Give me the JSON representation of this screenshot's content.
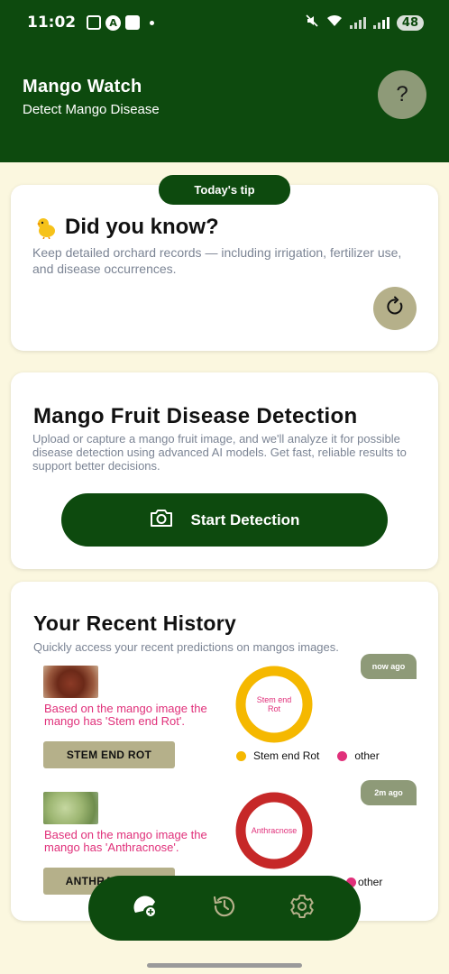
{
  "status_bar": {
    "time": "11:02",
    "battery": "48"
  },
  "header": {
    "title": "Mango Watch",
    "subtitle": "Detect Mango Disease",
    "help_label": "?"
  },
  "tip": {
    "badge": "Today's tip",
    "title": "Did you know?",
    "text": "Keep detailed orchard records — including irrigation, fertilizer use, and disease occurrences."
  },
  "detection": {
    "title": "Mango Fruit Disease Detection",
    "text": "Upload or capture a mango fruit image, and we'll analyze it for possible disease detection using advanced AI models. Get fast, reliable results to support better decisions.",
    "button_label": "Start Detection"
  },
  "history": {
    "title": "Your Recent History",
    "subtitle": "Quickly access your recent predictions on mangos images.",
    "items": [
      {
        "time": "now ago",
        "description": "Based on the mango image the mango has 'Stem end Rot'.",
        "label": "STEM END ROT",
        "chart_label": "Stem end Rot",
        "legend_primary": "Stem end Rot",
        "legend_other": "other",
        "color": "#f5b800"
      },
      {
        "time": "2m ago",
        "description": "Based on the mango image the mango has 'Anthracnose'.",
        "label": "ANTHRACNOSE",
        "chart_label": "Anthracnose",
        "legend_primary": "",
        "legend_other": "other",
        "color": "#c62828"
      }
    ]
  },
  "nav": {
    "items": [
      "scan-icon",
      "history-icon",
      "settings-icon"
    ]
  },
  "colors": {
    "primary": "#0d4a0e",
    "accent": "#8e9a78",
    "khaki": "#b5b08a",
    "pink": "#e0307a",
    "background": "#fbf7df"
  }
}
